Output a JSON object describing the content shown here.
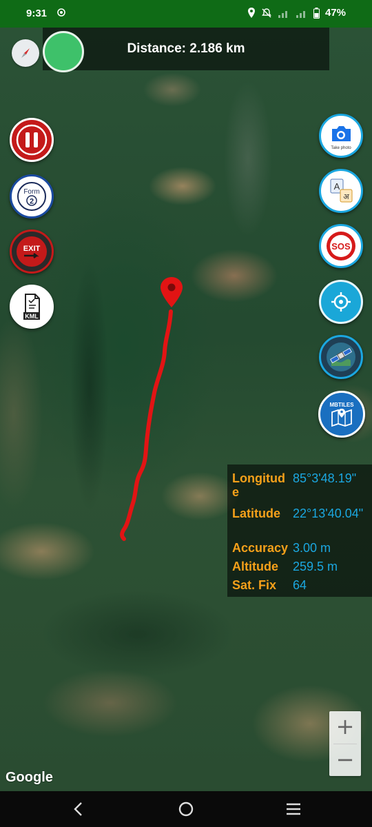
{
  "status_bar": {
    "time": "9:31",
    "battery": "47%"
  },
  "top_bar": {
    "distance": "Distance: 2.186 km"
  },
  "left_buttons": {
    "form_label": "Form",
    "form_number": "2",
    "exit_label": "EXIT",
    "kml_label": "KML"
  },
  "right_buttons": {
    "camera_label": "Take photo",
    "translate_a": "A",
    "translate_hi": "अ",
    "sos_label": "SOS",
    "mbtiles_label": "MBTILES"
  },
  "info_panel": {
    "longitude_label": "Longitud e",
    "longitude_value": "85°3'48.19\"",
    "latitude_label": "Latitude",
    "latitude_value": "22°13'40.04\"",
    "accuracy_label": "Accuracy",
    "accuracy_value": "3.00 m",
    "altitude_label": "Altitude",
    "altitude_value": "259.5 m",
    "satfix_label": "Sat. Fix",
    "satfix_value": "64"
  },
  "map": {
    "attribution": "Google",
    "track_color": "#e21414"
  },
  "zoom": {
    "in": "+",
    "out": "−"
  },
  "colors": {
    "status_bar": "#0f6b16",
    "label": "#f5a01a",
    "value": "#1ba7e0",
    "gps_dot": "#3ec16a"
  }
}
